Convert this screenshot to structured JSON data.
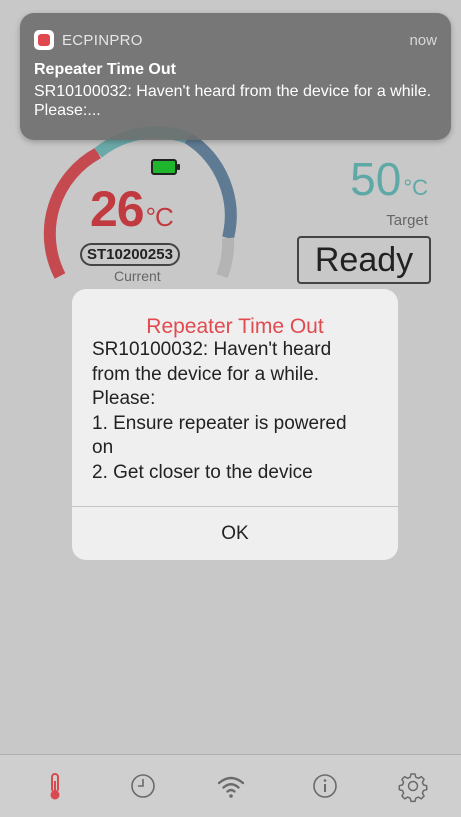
{
  "notification": {
    "app_name": "ECPINPRO",
    "time": "now",
    "title": "Repeater Time Out",
    "body": "SR10100032: Haven't heard from the device for a while. Please:..."
  },
  "gauge": {
    "current_value": "26",
    "current_unit": "°C",
    "sensor_id": "ST10200253",
    "current_label": "Current",
    "battery_icon": "battery-icon",
    "colors": {
      "hot": "#c03a40",
      "mid": "#5ea9a6",
      "cool": "#5f7b8f"
    }
  },
  "target": {
    "value": "50",
    "unit": "°C",
    "label": "Target",
    "status_label": "Ready"
  },
  "modal": {
    "title": "Repeater Time Out",
    "body_lines": [
      "SR10100032: Haven't heard",
      "from the device for a while.",
      "Please:",
      "1. Ensure repeater is powered",
      "on",
      "2. Get closer to the device"
    ],
    "ok_label": "OK"
  },
  "tabbar": {
    "tabs": [
      {
        "icon": "thermometer-icon",
        "active": true,
        "color": "#d94a4f"
      },
      {
        "icon": "clock-icon",
        "active": false
      },
      {
        "icon": "wifi-icon",
        "active": false
      },
      {
        "icon": "info-icon",
        "active": false
      },
      {
        "icon": "gear-icon",
        "active": false
      }
    ]
  }
}
